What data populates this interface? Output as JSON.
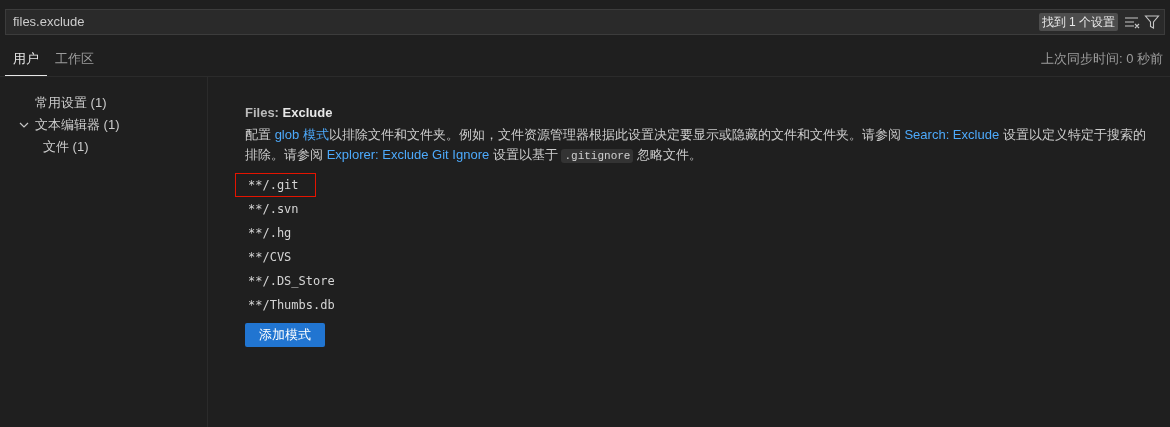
{
  "search": {
    "value": "files.exclude",
    "result_badge": "找到 1 个设置"
  },
  "tabs": [
    {
      "label": "用户",
      "selected": true
    },
    {
      "label": "工作区",
      "selected": false
    }
  ],
  "sync_status": "上次同步时间: 0 秒前",
  "tree": [
    {
      "label": "常用设置 (1)"
    },
    {
      "label": "文本编辑器 (1)",
      "expanded": true,
      "children": [
        {
          "label": "文件 (1)"
        }
      ]
    }
  ],
  "setting": {
    "category": "Files: ",
    "name": "Exclude",
    "description": [
      {
        "kind": "text",
        "text": "配置 "
      },
      {
        "kind": "link",
        "text": "glob 模式"
      },
      {
        "kind": "text",
        "text": "以排除文件和文件夹。例如，文件资源管理器根据此设置决定要显示或隐藏的文件和文件夹。请参阅 "
      },
      {
        "kind": "link",
        "text": "Search: Exclude"
      },
      {
        "kind": "text",
        "text": " 设置以定义特定于搜索的排除。请参阅 "
      },
      {
        "kind": "link",
        "text": "Explorer: Exclude Git Ignore"
      },
      {
        "kind": "text",
        "text": " 设置以基于 "
      },
      {
        "kind": "code",
        "text": ".gitignore"
      },
      {
        "kind": "text",
        "text": " 忽略文件。"
      }
    ],
    "patterns": [
      {
        "text": "**/.git",
        "highlighted": true
      },
      {
        "text": "**/.svn",
        "highlighted": false
      },
      {
        "text": "**/.hg",
        "highlighted": false
      },
      {
        "text": "**/CVS",
        "highlighted": false
      },
      {
        "text": "**/.DS_Store",
        "highlighted": false
      },
      {
        "text": "**/Thumbs.db",
        "highlighted": false
      }
    ],
    "add_button": "添加模式"
  }
}
